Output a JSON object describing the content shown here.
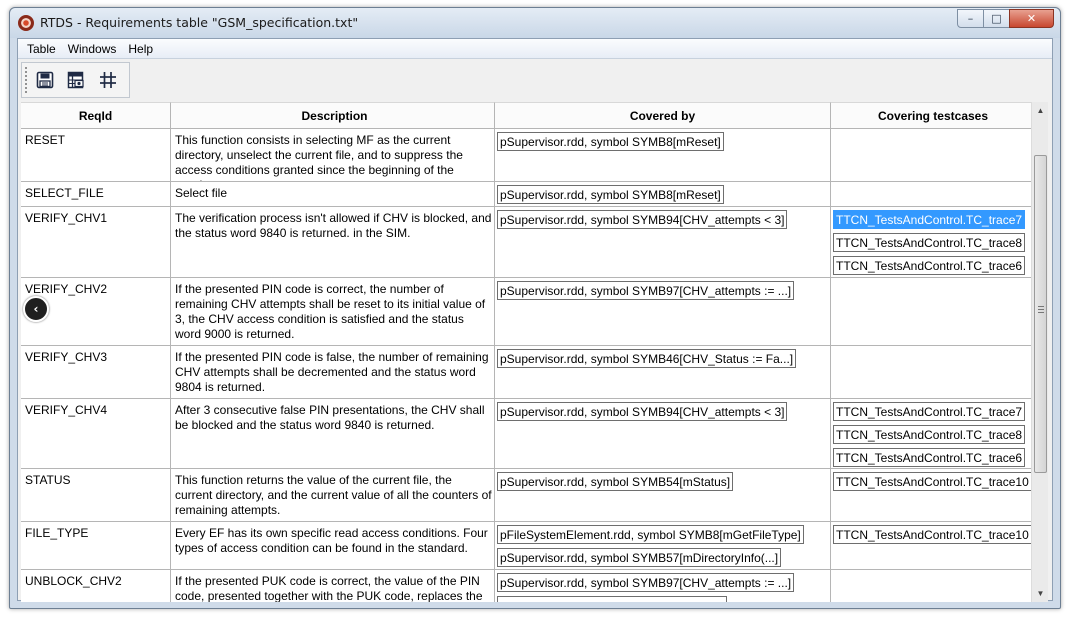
{
  "window": {
    "title": "RTDS - Requirements table \"GSM_specification.txt\"",
    "controls": {
      "minimize": "–",
      "maximize": "□",
      "close": "✕"
    }
  },
  "menu": [
    "Table",
    "Windows",
    "Help"
  ],
  "toolbar": {
    "buttons": [
      {
        "name": "save-icon"
      },
      {
        "name": "export-table-icon"
      },
      {
        "name": "grid-icon"
      }
    ]
  },
  "table": {
    "headers": [
      "ReqId",
      "Description",
      "Covered by",
      "Covering testcases"
    ],
    "rows": [
      {
        "id": "RESET",
        "description": "This function consists in selecting MF as the current directory, unselect the current file, and to suppress the access conditions granted since the beginning of the session",
        "covered_by": [
          "pSupervisor.rdd, symbol SYMB8[mReset]"
        ],
        "testcases": []
      },
      {
        "id": "SELECT_FILE",
        "description": "Select file",
        "covered_by": [
          "pSupervisor.rdd, symbol SYMB8[mReset]"
        ],
        "testcases": []
      },
      {
        "id": "VERIFY_CHV1",
        "description": "The verification process isn't allowed if CHV is blocked, and the status word 9840 is returned. in the SIM.",
        "covered_by": [
          "pSupervisor.rdd, symbol SYMB94[CHV_attempts < 3]"
        ],
        "testcases": [
          "TTCN_TestsAndControl.TC_trace7",
          "TTCN_TestsAndControl.TC_trace8",
          "TTCN_TestsAndControl.TC_trace6"
        ],
        "selected_testcase": 0
      },
      {
        "id": "VERIFY_CHV2",
        "description": "If the presented PIN code is correct, the number of remaining CHV attempts shall be reset to its initial value of 3, the CHV access condition is satisfied and the status word 9000 is returned.",
        "covered_by": [
          "pSupervisor.rdd, symbol SYMB97[CHV_attempts := ...]"
        ],
        "testcases": []
      },
      {
        "id": "VERIFY_CHV3",
        "description": "If the presented PIN code is false, the number of remaining CHV attempts shall be decremented and the status word 9804 is returned.",
        "covered_by": [
          "pSupervisor.rdd, symbol SYMB46[CHV_Status := Fa...]"
        ],
        "testcases": []
      },
      {
        "id": "VERIFY_CHV4",
        "description": "After 3 consecutive false PIN presentations, the CHV shall be blocked and the status word 9840 is returned.",
        "covered_by": [
          "pSupervisor.rdd, symbol SYMB94[CHV_attempts < 3]"
        ],
        "testcases": [
          "TTCN_TestsAndControl.TC_trace7",
          "TTCN_TestsAndControl.TC_trace8",
          "TTCN_TestsAndControl.TC_trace6"
        ]
      },
      {
        "id": "STATUS",
        "description": "This function returns the value of the current file, the current directory, and the current value of all the counters of remaining attempts.",
        "covered_by": [
          "pSupervisor.rdd, symbol SYMB54[mStatus]"
        ],
        "testcases": [
          "TTCN_TestsAndControl.TC_trace10"
        ]
      },
      {
        "id": "FILE_TYPE",
        "description": "Every EF has its own specific read access conditions. Four types of access condition can be found in the standard.",
        "covered_by": [
          "pFileSystemElement.rdd, symbol SYMB8[mGetFileType]",
          "pSupervisor.rdd, symbol SYMB57[mDirectoryInfo(...]"
        ],
        "testcases": [
          "TTCN_TestsAndControl.TC_trace10"
        ]
      },
      {
        "id": "UNBLOCK_CHV2",
        "description": "If the presented PUK code is correct, the value of the PIN code, presented together with the PUK code, replaces the",
        "covered_by": [
          "pSupervisor.rdd, symbol SYMB97[CHV_attempts := ...]",
          ""
        ],
        "testcases": []
      }
    ]
  },
  "row_heights": [
    53,
    25,
    71,
    68,
    53,
    70,
    53,
    48,
    40
  ],
  "floating_button": "‹"
}
